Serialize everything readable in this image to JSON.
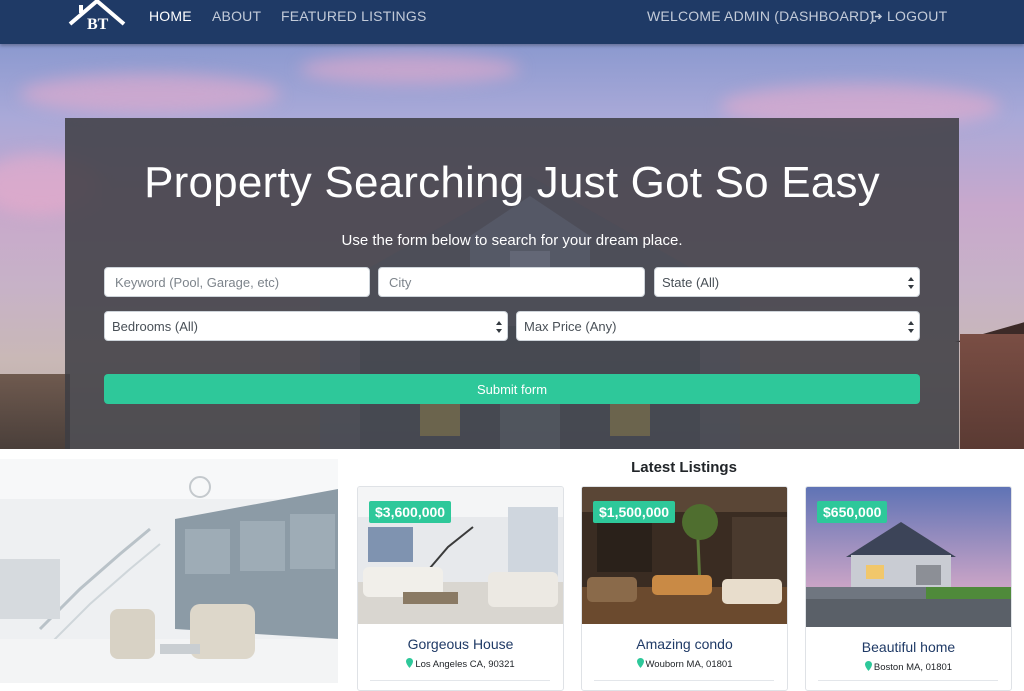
{
  "nav": {
    "logo_text": "BT",
    "links": [
      {
        "label": "HOME"
      },
      {
        "label": "ABOUT"
      },
      {
        "label": "FEATURED LISTINGS"
      }
    ],
    "welcome_label": "WELCOME ADMIN (DASHBOARD)",
    "logout_label": "LOGOUT"
  },
  "hero": {
    "title": "Property Searching Just Got So Easy",
    "subtitle": "Use the form below to search for your dream place.",
    "form": {
      "keyword_placeholder": "Keyword (Pool, Garage, etc)",
      "city_placeholder": "City",
      "state_selected": "State (All)",
      "bedrooms_selected": "Bedrooms (All)",
      "max_price_selected": "Max Price (Any)",
      "submit_label": "Submit form"
    }
  },
  "latest": {
    "heading": "Latest Listings",
    "listings": [
      {
        "price": "$3,600,000",
        "title": "Gorgeous House",
        "location": "Los Angeles CA, 90321"
      },
      {
        "price": "$1,500,000",
        "title": "Amazing condo",
        "location": "Wouborn MA, 01801"
      },
      {
        "price": "$650,000",
        "title": "Beautiful home",
        "location": "Boston MA, 01801"
      }
    ]
  },
  "colors": {
    "navbar": "#1f3a66",
    "accent": "#2ec89a",
    "card_title": "#1f3a66"
  },
  "icons": {
    "logo": "house-roof-logo-icon",
    "logout": "sign-out-icon",
    "location": "map-pin-icon",
    "select": "select-arrows-icon"
  }
}
